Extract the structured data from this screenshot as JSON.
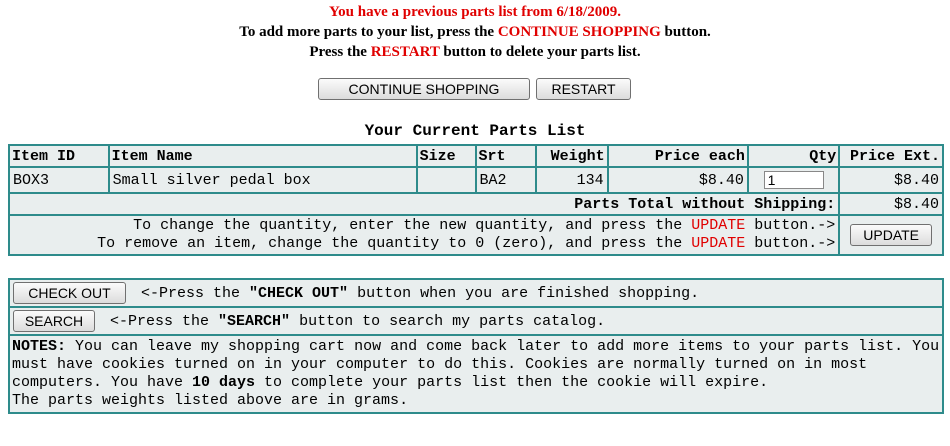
{
  "message": {
    "line1": "You have a previous parts list from 6/18/2009.",
    "line2_pre": "To add more parts to your list, press the ",
    "line2_highlight": "CONTINUE SHOPPING",
    "line2_post": " button.",
    "line3_pre": "Press the ",
    "line3_highlight": "RESTART",
    "line3_post": " button to delete your parts list."
  },
  "buttons": {
    "continue_shopping": "CONTINUE SHOPPING",
    "restart": "RESTART",
    "update": "UPDATE",
    "check_out": "CHECK OUT",
    "search": "SEARCH"
  },
  "parts_list": {
    "title": "Your Current Parts List",
    "headers": {
      "item_id": "Item ID",
      "item_name": "Item Name",
      "size": "Size",
      "srt": "Srt",
      "weight": "Weight",
      "price_each": "Price each",
      "qty": "Qty",
      "price_ext": "Price Ext."
    },
    "rows": [
      {
        "item_id": "BOX3",
        "item_name": "Small silver pedal box",
        "size": "",
        "srt": "BA2",
        "weight": "134",
        "price_each": "$8.40",
        "qty": "1",
        "price_ext": "$8.40"
      }
    ],
    "total_label": "Parts Total without Shipping:",
    "total_value": "$8.40",
    "help_line1_pre": "To change the quantity, enter the new quantity, and press the ",
    "help_line1_post": " button.->",
    "help_line2_pre": "To remove an item, change the quantity to 0 (zero), and press the ",
    "help_line2_post": " button.->",
    "help_highlight": "UPDATE"
  },
  "actions": {
    "checkout_pre": "<-Press the ",
    "checkout_quoted": "\"CHECK OUT\"",
    "checkout_post": " button when you are finished shopping.",
    "search_pre": "<-Press the ",
    "search_quoted": "\"SEARCH\"",
    "search_post": " button to search my parts catalog."
  },
  "notes": {
    "label": "NOTES:",
    "text1": " You can leave my shopping cart now and come back later to add more items to your parts list. You must have cookies turned on in your computer to do this. Cookies are normally turned on in most computers. You have ",
    "bold_days": "10 days",
    "text2": " to complete your parts list then the cookie will expire.",
    "weights": "The parts weights listed above are in grams."
  }
}
